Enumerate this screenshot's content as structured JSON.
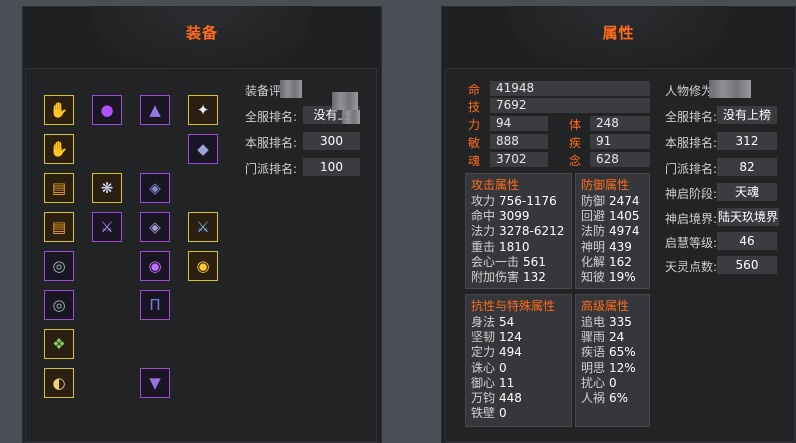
{
  "equipment": {
    "title": "装备",
    "labels": {
      "gear_rating": "装备评",
      "server_rank": "全服排名:",
      "local_rank": "本服排名:",
      "sect_rank": "门派排名:"
    },
    "values": {
      "server_rank": "没有上",
      "local_rank": "300",
      "sect_rank": "100"
    },
    "slots": [
      {
        "icon": "claw-weapon-icon",
        "glyph": "✋",
        "color": "#ffcc33"
      },
      {
        "icon": "purple-orb-icon",
        "glyph": "●",
        "color": "#b050ff"
      },
      {
        "icon": "dark-helmet-icon",
        "glyph": "▲",
        "color": "#8e7adf"
      },
      {
        "icon": "white-crane-icon",
        "glyph": "✦",
        "color": "#e8f0ff"
      },
      {
        "icon": "claw-weapon-icon",
        "glyph": "✋",
        "color": "#ffcc33"
      },
      {
        "icon": "armor-shoulder-icon",
        "glyph": "◆",
        "color": "#9aa4d8"
      },
      {
        "icon": "scroll-book-icon",
        "glyph": "▤",
        "color": "#f0a020"
      },
      {
        "icon": "feather-wing-icon",
        "glyph": "❋",
        "color": "#d8d8ff"
      },
      {
        "icon": "armor-chest-icon",
        "glyph": "◈",
        "color": "#7f8fcf"
      },
      {
        "icon": "scroll-book-icon",
        "glyph": "▤",
        "color": "#f0a020"
      },
      {
        "icon": "blade-weapon-icon",
        "glyph": "⚔",
        "color": "#b890ff"
      },
      {
        "icon": "armor-pauldron-icon",
        "glyph": "◈",
        "color": "#9e9ecf"
      },
      {
        "icon": "twin-blade-icon",
        "glyph": "⚔",
        "color": "#7fb0ff"
      },
      {
        "icon": "bracer-icon",
        "glyph": "◎",
        "color": "#a0c0c0"
      },
      {
        "icon": "dark-ring-icon",
        "glyph": "◉",
        "color": "#c070ff"
      },
      {
        "icon": "golden-orb-icon",
        "glyph": "◉",
        "color": "#ffcc33"
      },
      {
        "icon": "bracer-icon",
        "glyph": "◎",
        "color": "#a0c0c0"
      },
      {
        "icon": "leg-armor-icon",
        "glyph": "Π",
        "color": "#6f7fdf"
      },
      {
        "icon": "green-amulet-icon",
        "glyph": "❖",
        "color": "#7fd060"
      },
      {
        "icon": "golden-scroll-icon",
        "glyph": "◐",
        "color": "#f0d080"
      },
      {
        "icon": "boots-icon",
        "glyph": "▼",
        "color": "#9a6fdf"
      }
    ]
  },
  "attributes": {
    "title": "属性",
    "base": [
      {
        "key": "命",
        "value": "41948"
      },
      {
        "key": "技",
        "value": "7692"
      }
    ],
    "pairs": [
      {
        "k1": "力",
        "v1": "94",
        "k2": "体",
        "v2": "248"
      },
      {
        "k1": "敏",
        "v1": "888",
        "k2": "疾",
        "v2": "91"
      },
      {
        "k1": "魂",
        "v1": "3702",
        "k2": "念",
        "v2": "628"
      }
    ],
    "attack": {
      "title": "攻击属性",
      "rows": [
        {
          "k": "攻力",
          "v": "756-1176"
        },
        {
          "k": "命中",
          "v": "3099"
        },
        {
          "k": "法力",
          "v": "3278-6212"
        },
        {
          "k": "重击",
          "v": "1810"
        },
        {
          "k": "会心一击",
          "v": "561"
        },
        {
          "k": "附加伤害",
          "v": "132"
        }
      ]
    },
    "defense": {
      "title": "防御属性",
      "rows": [
        {
          "k": "防御",
          "v": "2474"
        },
        {
          "k": "回避",
          "v": "1405"
        },
        {
          "k": "法防",
          "v": "4974"
        },
        {
          "k": "神明",
          "v": "439"
        },
        {
          "k": "化解",
          "v": "162"
        },
        {
          "k": "知彼",
          "v": "19%"
        }
      ]
    },
    "resist": {
      "title": "抗性与特殊属性",
      "rows": [
        {
          "k": "身法",
          "v": "54"
        },
        {
          "k": "坚韧",
          "v": "124"
        },
        {
          "k": "定力",
          "v": "494"
        },
        {
          "k": "诛心",
          "v": "0"
        },
        {
          "k": "御心",
          "v": "11"
        },
        {
          "k": "万钧",
          "v": "448"
        },
        {
          "k": "铁壁",
          "v": "0"
        }
      ]
    },
    "advanced": {
      "title": "高级属性",
      "rows": [
        {
          "k": "追电",
          "v": "335"
        },
        {
          "k": "骤雨",
          "v": "24"
        },
        {
          "k": "疾语",
          "v": "65%"
        },
        {
          "k": "明思",
          "v": "12%"
        },
        {
          "k": "扰心",
          "v": "0"
        },
        {
          "k": "人祸",
          "v": "6%"
        }
      ]
    },
    "side": [
      {
        "label": "人物修为",
        "value": ""
      },
      {
        "label": "全服排名:",
        "value": "没有上榜"
      },
      {
        "label": "本服排名:",
        "value": "312"
      },
      {
        "label": "门派排名:",
        "value": "82"
      },
      {
        "label": "神启阶段:",
        "value": "天魂"
      },
      {
        "label": "神启境界:",
        "value": "陆天玖境界"
      },
      {
        "label": "启慧等级:",
        "value": "46"
      },
      {
        "label": "天灵点数:",
        "value": "560"
      }
    ]
  }
}
